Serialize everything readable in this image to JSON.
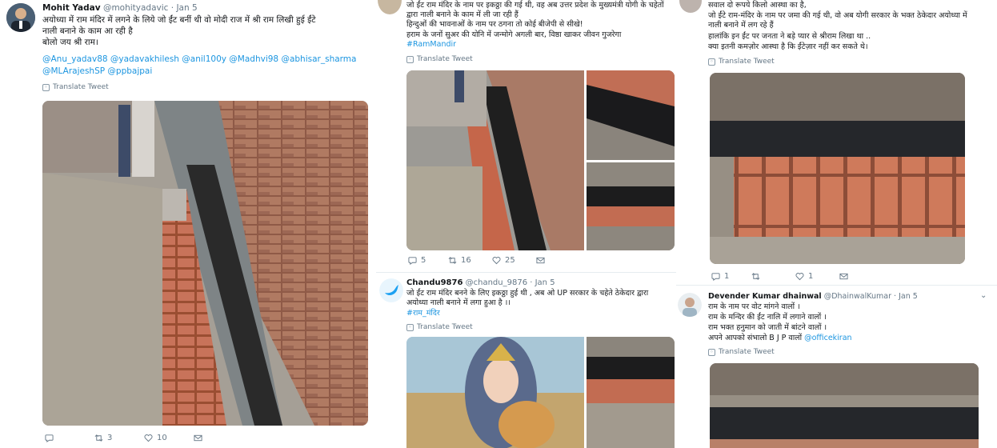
{
  "colors": {
    "link": "#1b95e0",
    "muted": "#657786",
    "text": "#14171a",
    "divider": "#e6ecf0"
  },
  "col1": {
    "tweet": {
      "name": "Mohit Yadav",
      "handle": "@mohityadavic",
      "date": "· Jan 5",
      "lines": [
        "अयोध्या में राम मंदिर में लगने के लिये जो ईंट बनीं थी वो मोदी राज में श्री राम लिखी हुई ईंटे",
        "नाली बनाने के काम आ रही है",
        "बोलो  जय श्री राम।"
      ],
      "mentions": [
        "@Anu_yadav88 @yadavakhilesh @anil100y @Madhvi98 @abhisar_sharma",
        "@MLArajeshSP @ppbajpai"
      ],
      "translate": "Translate Tweet",
      "replies": "",
      "retweets": "3",
      "likes": "10"
    }
  },
  "col2": {
    "tweet1": {
      "lines": [
        "जो ईंट राम मंदिर के नाम पर इकठ्ठा की गई थी, वह अब उत्तर प्रदेश के मुख्यमंत्री योगी के चहेतों",
        "द्वारा नाली बनाने के काम में ली जा रही हैं",
        "हिन्दुओं की भावनाओं के नाम पर ठगना तो कोई बीजेपी से सीखे!",
        "हराम के जनों सुअर की योनि में जन्मोगे अगली बार, विष्ठा खाकर जीवन गुजरेगा"
      ],
      "hashtag": "#RamMandir",
      "translate": "Translate Tweet",
      "replies": "5",
      "retweets": "16",
      "likes": "25"
    },
    "tweet2": {
      "name": "Chandu9876",
      "handle": "@chandu_9876",
      "date": "· Jan 5",
      "lines": [
        "जो ईंट राम मंदिर बनने के लिए इकठ्ठा हुई थी ,  अब ओ UP सरकार के चहेते ठेकेदार द्वारा",
        "अयोध्या नाली बनाने में लगा हुआ है ।।"
      ],
      "hashtag": "#राम_मंदिर",
      "translate": "Translate Tweet"
    }
  },
  "col3": {
    "tweet1": {
      "lines": [
        "सवाल दो रूपये किलो आस्था का है,",
        "जो ईंटे राम-मंदिर के नाम पर जमा की गई थी, वो अब योगी सरकार के भक्त ठेकेदार अयोध्या में",
        "नाली बनाने में लग रहे हैं",
        "हालांकि इन ईंट पर जनता ने बड़े प्यार से श्रीराम लिखा था ..",
        "क्या इतनी कमज़ोर आस्था है कि ईंटेज़ार नहीं कर सकते थे।"
      ],
      "translate": "Translate Tweet",
      "replies": "1",
      "retweets": "",
      "likes": "1"
    },
    "tweet2": {
      "name": "Devender Kumar dhainwal",
      "handle": "@DhainwalKumar",
      "date": "· Jan 5",
      "lines": [
        "राम के नाम पर वोट मांगने वालों ।",
        "राम के मन्दिर की ईंट नालि में लगाने वालों ।",
        "राम भक्त हनुमान को जाती में बांटने वालों ।"
      ],
      "last_line": "अपने आपको संभालो B J P  वालों",
      "last_mention": "@officekiran",
      "translate": "Translate Tweet"
    }
  }
}
